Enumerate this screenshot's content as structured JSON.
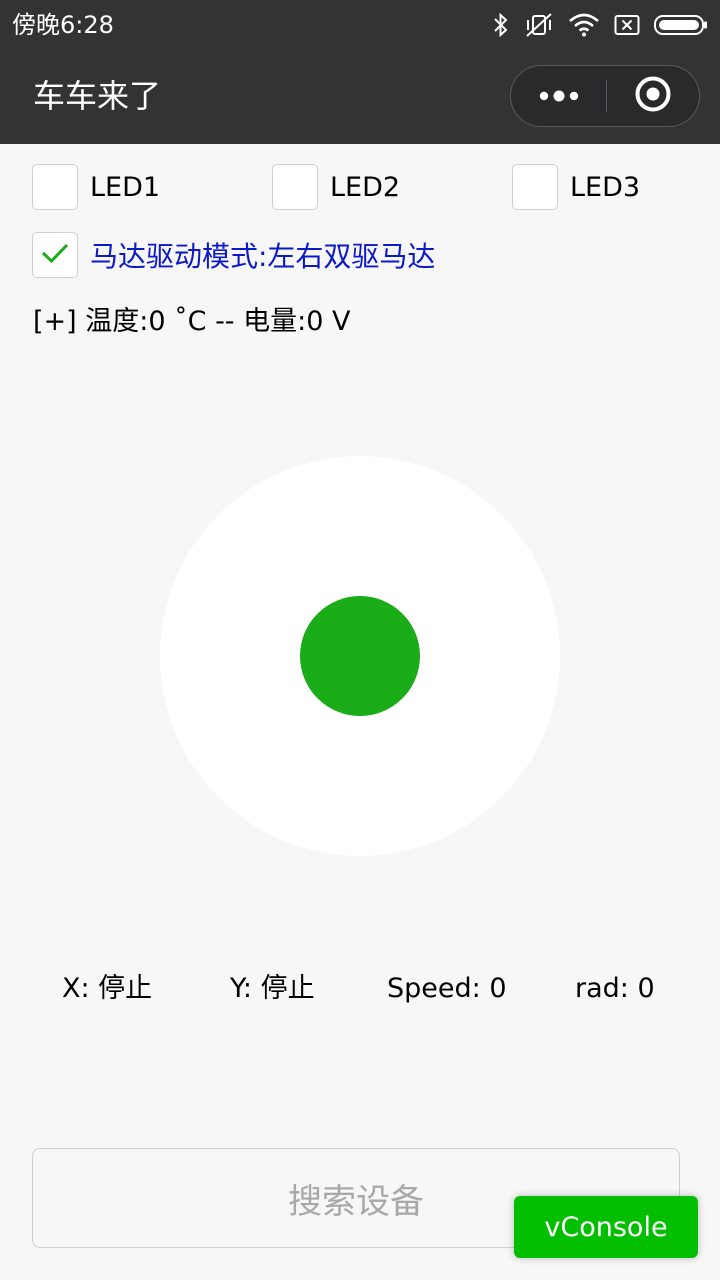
{
  "status_bar": {
    "time": "傍晚6:28",
    "icons": [
      "bluetooth-icon",
      "vibrate-off-icon",
      "wifi-icon",
      "sim-none-icon",
      "battery-icon"
    ]
  },
  "nav": {
    "title": "车车来了",
    "more_icon": "more-dots-icon",
    "close_icon": "target-circle-icon"
  },
  "leds": [
    {
      "label": "LED1",
      "checked": false
    },
    {
      "label": "LED2",
      "checked": false
    },
    {
      "label": "LED3",
      "checked": false
    }
  ],
  "motor_mode": {
    "label": "马达驱动模式:左右双驱马达",
    "checked": true,
    "color": "#0b19c8"
  },
  "info": {
    "text": "[+] 温度:0 ˚C -- 电量:0 V"
  },
  "joystick": {
    "knob_color": "#1aad19",
    "x_offset": 0,
    "y_offset": 0
  },
  "readouts": {
    "x": "X: 停止",
    "y": "Y: 停止",
    "speed": "Speed: 0",
    "rad": "rad: 0"
  },
  "search_button": {
    "label": "搜索设备"
  },
  "vconsole": {
    "label": "vConsole",
    "color": "#04be02"
  }
}
